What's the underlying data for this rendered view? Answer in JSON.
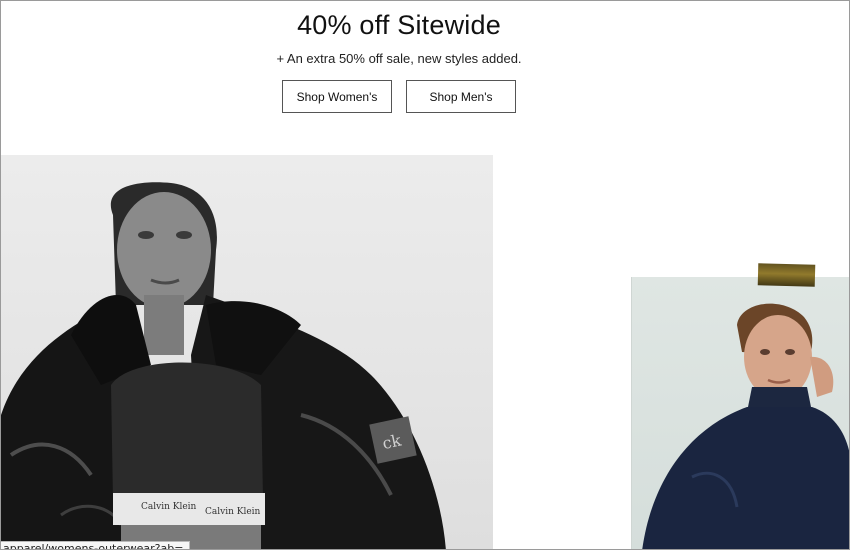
{
  "promo": {
    "headline": "40% off Sitewide",
    "subline": "+ An extra 50% off sale, new styles added."
  },
  "buttons": {
    "shop_women": "Shop Women's",
    "shop_men": "Shop Men's"
  },
  "photos": {
    "women_waistband_text_1": "Calvin Klein",
    "women_waistband_text_2": "Calvin Klein"
  },
  "status_bar": {
    "url": "apparel/womens-outerwear?ab="
  }
}
